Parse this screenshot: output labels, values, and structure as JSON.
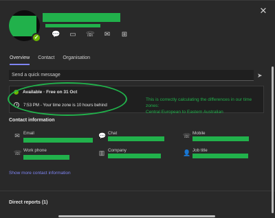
{
  "window": {
    "close_glyph": "✕"
  },
  "profile": {
    "icons": [
      "chat-icon",
      "video-call-icon",
      "phone-call-icon",
      "email-icon",
      "org-chart-icon"
    ],
    "accent": "#7f85f5",
    "presence_color": "#6bb700",
    "redaction_color": "#21b14b"
  },
  "tabs": [
    {
      "label": "Overview",
      "active": true
    },
    {
      "label": "Contact",
      "active": false
    },
    {
      "label": "Organisation",
      "active": false
    }
  ],
  "quick_message": {
    "placeholder": "Send a quick message"
  },
  "availability": {
    "status": "Available · Free on 31 Oct",
    "time_zone": "7:53 PM - Your time zone is 10 hours behind"
  },
  "annotation": {
    "line1": "This is correctly calculating the differences in our time",
    "line2": "zones:",
    "line3": "Central European to Eastern Australian"
  },
  "contact_info": {
    "title": "Contact information",
    "email_label": "Email",
    "chat_label": "Chat",
    "mobile_label": "Mobile",
    "work_phone_label": "Work phone",
    "company_label": "Company",
    "job_title_label": "Job title"
  },
  "show_more": "Show more contact information",
  "direct_reports": "Direct reports (1)"
}
